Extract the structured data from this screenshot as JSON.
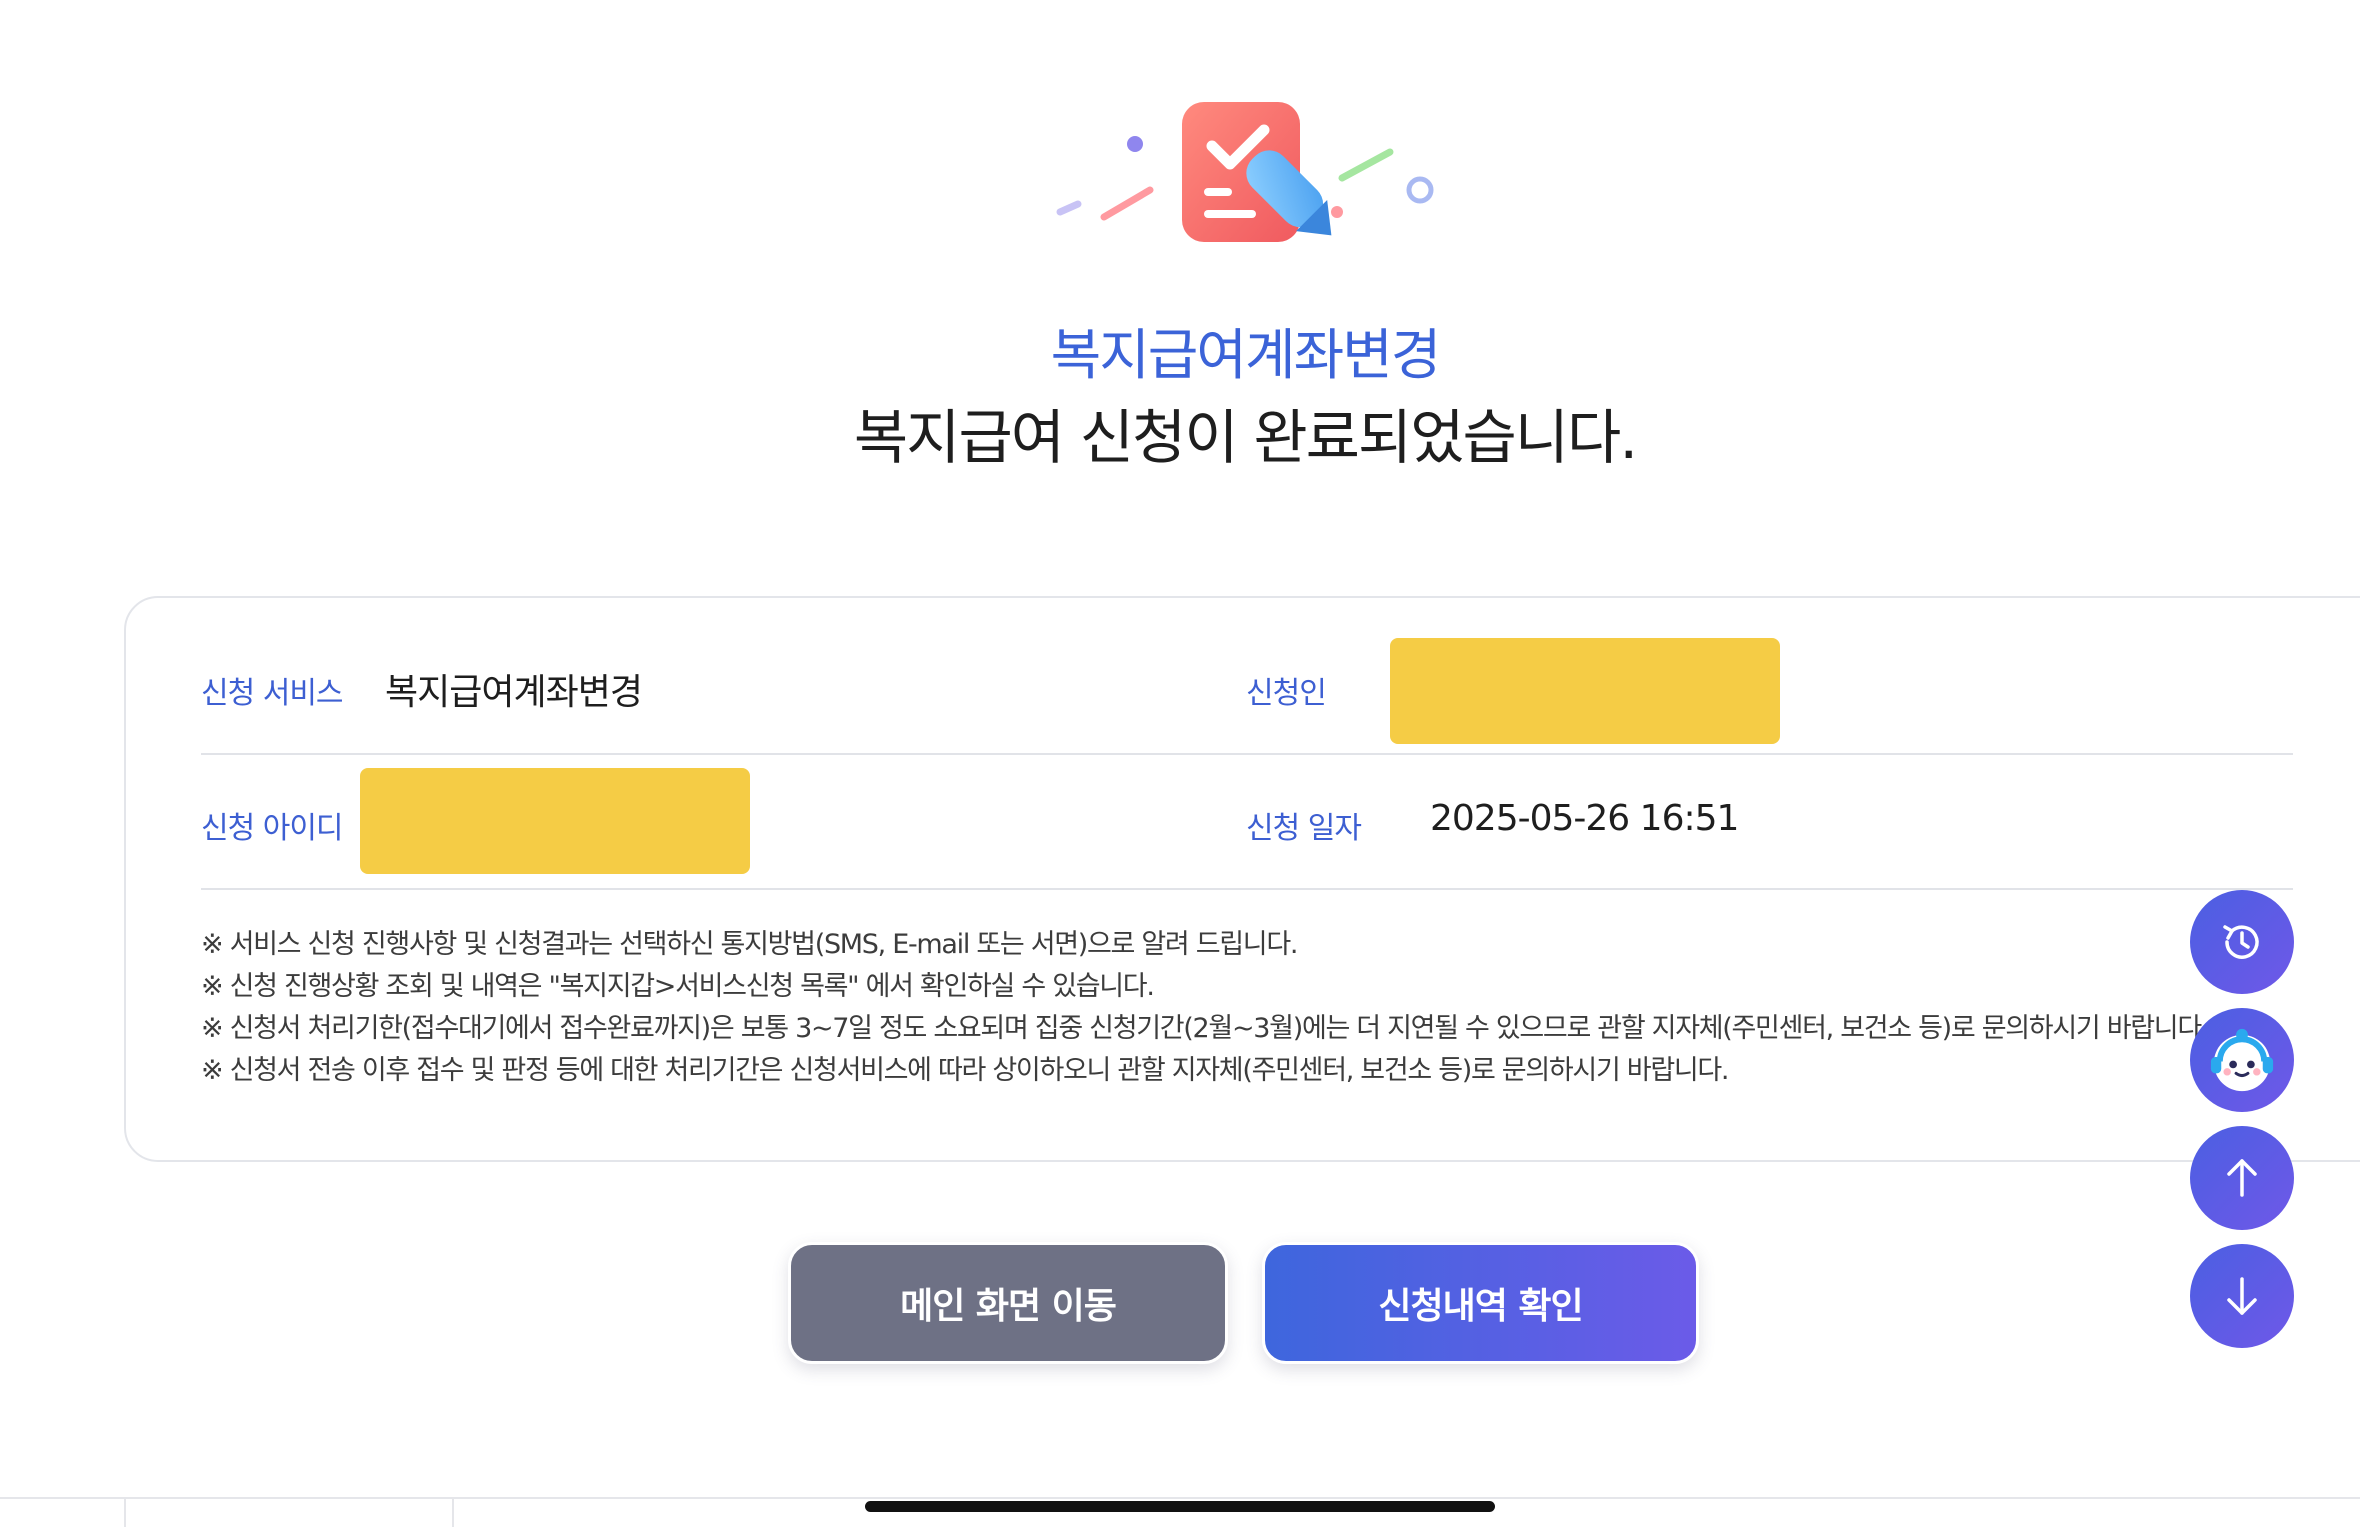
{
  "header": {
    "icon": "checklist-pen-icon",
    "service_title": "복지급여계좌변경",
    "complete_message": "복지급여 신청이 완료되었습니다."
  },
  "info": {
    "service_label": "신청 서비스",
    "service_value": "복지급여계좌변경",
    "applicant_label": "신청인",
    "applicant_value": "",
    "id_label": "신청 아이디",
    "id_value": "",
    "date_label": "신청 일자",
    "date_value": "2025-05-26 16:51"
  },
  "notices": [
    "※ 서비스 신청 진행사항 및 신청결과는 선택하신 통지방법(SMS, E-mail 또는 서면)으로 알려 드립니다.",
    "※ 신청 진행상황 조회 및 내역은 \"복지지갑>서비스신청 목록\" 에서 확인하실 수 있습니다.",
    "※ 신청서 처리기한(접수대기에서 접수완료까지)은 보통 3~7일 정도 소요되며 집중 신청기간(2월~3월)에는 더 지연될 수 있으므로 관할 지자체(주민센터, 보건소 등)로 문의하시기 바랍니다.",
    "※ 신청서 전송 이후 접수 및 판정 등에 대한 처리기간은 신청서비스에 따라 상이하오니 관할 지자체(주민센터, 보건소 등)로 문의하시기 바랍니다."
  ],
  "buttons": {
    "main": "메인 화면 이동",
    "history": "신청내역 확인"
  },
  "fabs": [
    "recent-history-icon",
    "chatbot-icon",
    "arrow-up-icon",
    "arrow-down-icon"
  ],
  "colors": {
    "accent": "#3b63d8",
    "masked": "#f5cc45",
    "gray_button": "#6e7185",
    "fab": "#5b5be6"
  }
}
